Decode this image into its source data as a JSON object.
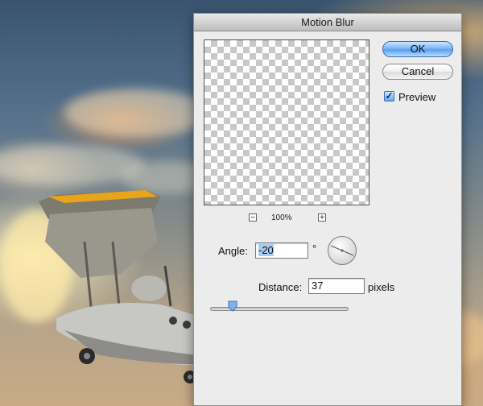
{
  "dialog": {
    "title": "Motion Blur",
    "ok_label": "OK",
    "cancel_label": "Cancel",
    "preview_label": "Preview",
    "preview_checked": true,
    "zoom": {
      "level": "100%",
      "zoom_out_icon": "minus-icon",
      "zoom_in_icon": "plus-icon",
      "zoom_out_symbol": "−",
      "zoom_in_symbol": "+"
    },
    "angle": {
      "label": "Angle:",
      "value": "-20",
      "unit": "°"
    },
    "distance": {
      "label": "Distance:",
      "value": "37",
      "unit": "pixels",
      "slider_fraction": 0.16
    }
  },
  "colors": {
    "ok_button": "#6aa9ef",
    "selection": "#a9cbf1"
  }
}
